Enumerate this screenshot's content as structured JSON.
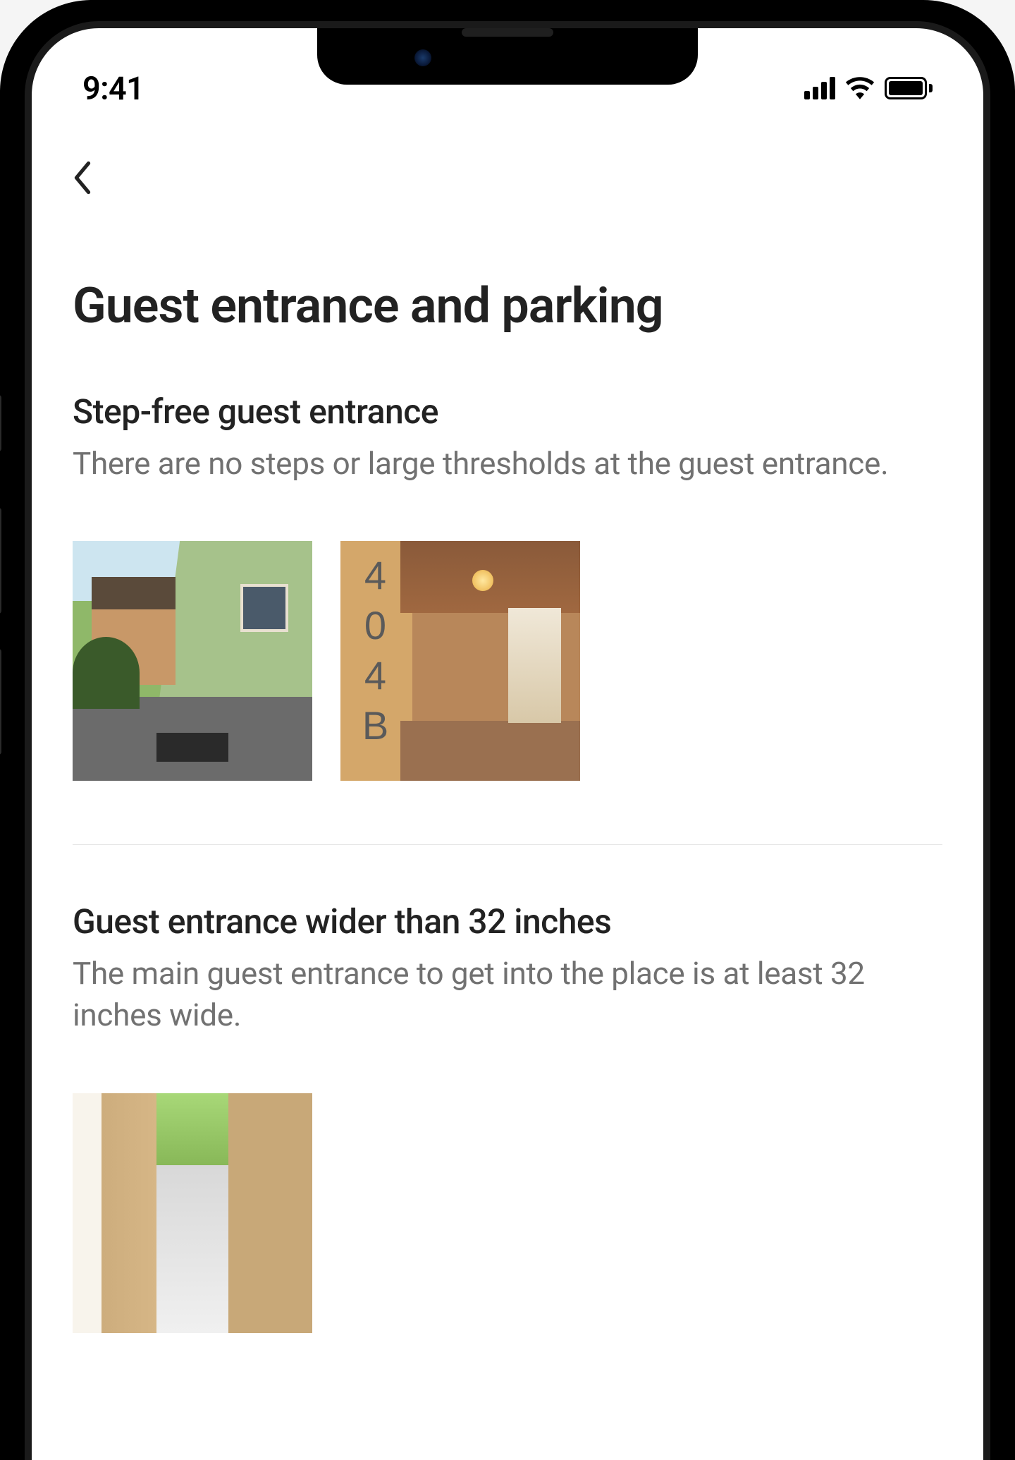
{
  "status_bar": {
    "time": "9:41"
  },
  "page": {
    "title": "Guest entrance and parking"
  },
  "features": [
    {
      "title": "Step-free guest entrance",
      "description": "There are no steps or large thresholds at the guest entrance.",
      "photo_count": 2,
      "house_number": "404B"
    },
    {
      "title": "Guest entrance wider than 32 inches",
      "description": "The main guest entrance to get into the place is at least 32 inches wide.",
      "photo_count": 1
    }
  ]
}
